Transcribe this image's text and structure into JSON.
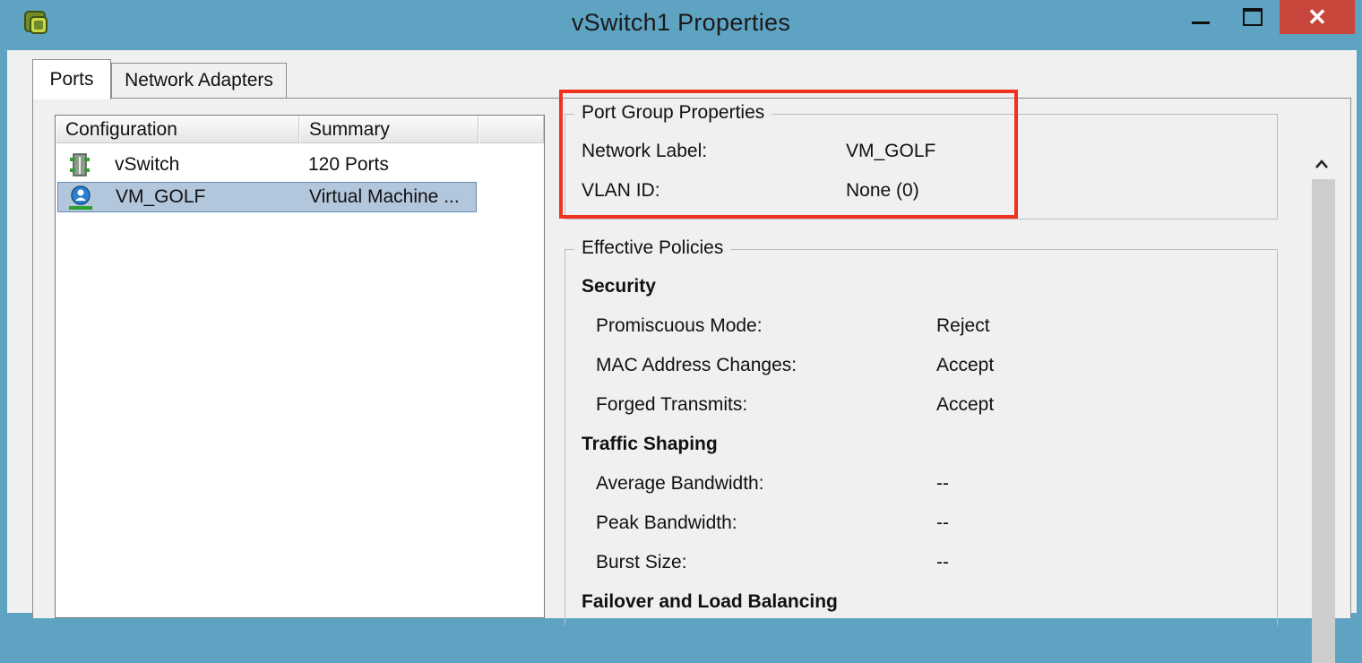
{
  "window": {
    "title": "vSwitch1 Properties",
    "close_glyph": "✕"
  },
  "tabs": [
    {
      "label": "Ports",
      "selected": true
    },
    {
      "label": "Network Adapters",
      "selected": false
    }
  ],
  "ports_list": {
    "columns": [
      "Configuration",
      "Summary"
    ],
    "rows": [
      {
        "icon": "vswitch-icon",
        "name": "vSwitch",
        "summary": "120 Ports",
        "selected": false
      },
      {
        "icon": "virtual-machine-network-icon",
        "name": "VM_GOLF",
        "summary": "Virtual Machine ...",
        "selected": true
      }
    ]
  },
  "port_group_properties": {
    "legend": "Port Group Properties",
    "fields": [
      {
        "label": "Network Label:",
        "value": "VM_GOLF"
      },
      {
        "label": "VLAN ID:",
        "value": "None (0)"
      }
    ]
  },
  "effective_policies": {
    "legend": "Effective Policies",
    "sections": [
      {
        "heading": "Security",
        "fields": [
          {
            "label": "Promiscuous Mode:",
            "value": "Reject"
          },
          {
            "label": "MAC Address Changes:",
            "value": "Accept"
          },
          {
            "label": "Forged Transmits:",
            "value": "Accept"
          }
        ]
      },
      {
        "heading": "Traffic Shaping",
        "fields": [
          {
            "label": "Average Bandwidth:",
            "value": "--"
          },
          {
            "label": "Peak Bandwidth:",
            "value": "--"
          },
          {
            "label": "Burst Size:",
            "value": "--"
          }
        ]
      },
      {
        "heading": "Failover and Load Balancing",
        "fields": []
      }
    ]
  },
  "colors": {
    "titlebar": "#5ea3c2",
    "close_button": "#c9463d",
    "selection": "#b2c6dc",
    "highlight_box": "#f0321e"
  }
}
